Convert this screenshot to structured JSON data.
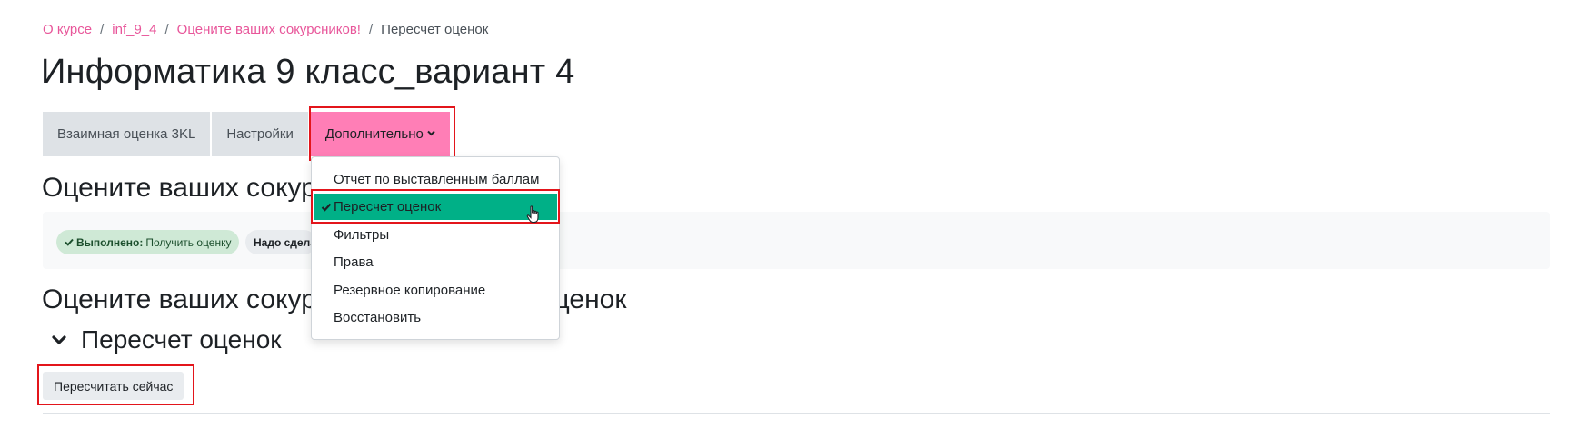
{
  "breadcrumb": {
    "items": [
      "О курсе",
      "inf_9_4",
      "Оцените ваших сокурсников!"
    ],
    "separator": "/",
    "current": "Пересчет оценок"
  },
  "page_title": "Информатика 9 класс_вариант 4",
  "secondary_nav": {
    "tabs": [
      "Взаимная оценка 3KL",
      "Настройки"
    ],
    "more_label": "Дополнительно"
  },
  "activity": {
    "heading": "Оцените ваших сокурсников!",
    "completion": {
      "done_label": "Выполнено:",
      "done_text": "Получить оценку",
      "todo_label": "Надо сделать:"
    }
  },
  "section_heading_left": "Оцените ваших сокур",
  "section_heading_right": "оценок",
  "recalc": {
    "heading": "Пересчет оценок",
    "button": "Пересчитать сейчас"
  },
  "dropdown": {
    "items": [
      "Отчет по выставленным баллам",
      "Пересчет оценок",
      "Фильтры",
      "Права",
      "Резервное копирование",
      "Восстановить"
    ],
    "active_index": 1
  },
  "colors": {
    "link": "#e8569a",
    "more_button_bg": "#ff7eb6",
    "active_item_bg": "#00b087",
    "annotation_frame": "#e3151b",
    "done_badge_bg": "#cfe9d6"
  }
}
